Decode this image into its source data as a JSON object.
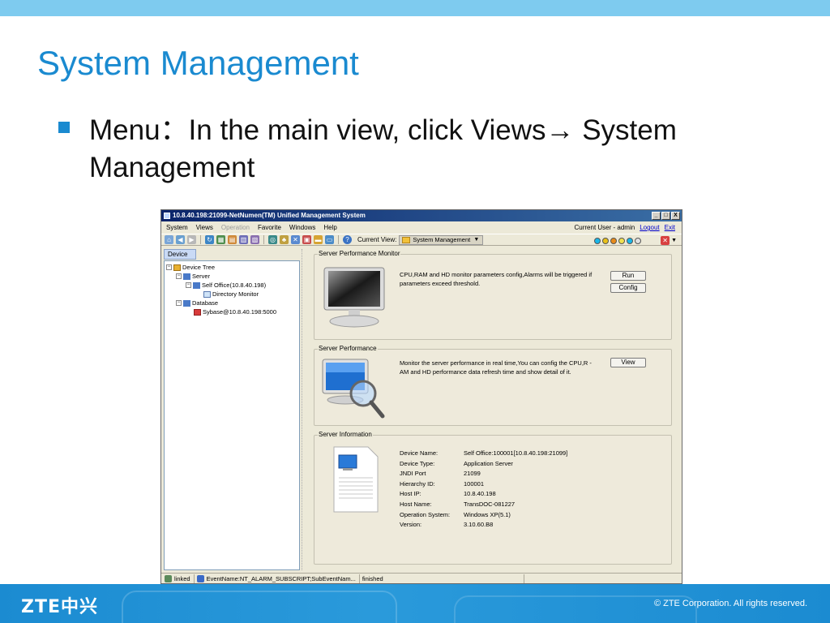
{
  "slide": {
    "title": "System Management",
    "bullet": "Menu：In the main view, click Views→ System Management",
    "footer_logo": "ZTE中兴",
    "footer_copyright": "© ZTE Corporation. All rights reserved."
  },
  "window": {
    "title": "10.8.40.198:21099-NetNumen(TM) Unified Management System",
    "buttons": {
      "minimize": "_",
      "maximize": "□",
      "close": "X"
    }
  },
  "menu": {
    "items": [
      "System",
      "Views",
      "Operation",
      "Favorite",
      "Windows",
      "Help"
    ],
    "current_user": "Current User - admin",
    "logout": "Logout",
    "exit": "Exit"
  },
  "toolbar": {
    "current_view_label": "Current View:",
    "current_view_value": "System Management"
  },
  "device_panel": {
    "tab": "Device",
    "tree": {
      "root": "Device Tree",
      "server": "Server",
      "self_office": "Self Office(10.8.40.198)",
      "directory_monitor": "Directory Monitor",
      "database": "Database",
      "sybase": "Sybase@10.8.40.198:5000"
    }
  },
  "server_monitor": {
    "title": "Server Performance Monitor",
    "description": "CPU,RAM and HD monitor parameters config,Alarms will be triggered if parameters exceed threshold.",
    "run_button": "Run",
    "config_button": "Config"
  },
  "server_performance": {
    "title": "Server Performance",
    "description": "Monitor the server performance in real time,You can config the CPU,R -AM and HD performance data refresh time and show detail of it.",
    "view_button": "View"
  },
  "server_info": {
    "title": "Server Information",
    "rows": [
      {
        "label": "Device Name:",
        "value": "Self Office:100001[10.8.40.198:21099]"
      },
      {
        "label": "Device Type:",
        "value": "Application Server"
      },
      {
        "label": "JNDI Port",
        "value": "21099"
      },
      {
        "label": "Hierarchy ID:",
        "value": "100001"
      },
      {
        "label": "Host IP:",
        "value": "10.8.40.198"
      },
      {
        "label": "Host Name:",
        "value": "TransDOC-081227"
      },
      {
        "label": "Operation System:",
        "value": "Windows XP(5.1)"
      },
      {
        "label": "Version:",
        "value": "3.10.60.B8"
      }
    ]
  },
  "statusbar": {
    "linked": "linked",
    "event": "EventName:NT_ALARM_SUBSCRIPT;SubEventNam...",
    "state": "finished"
  }
}
